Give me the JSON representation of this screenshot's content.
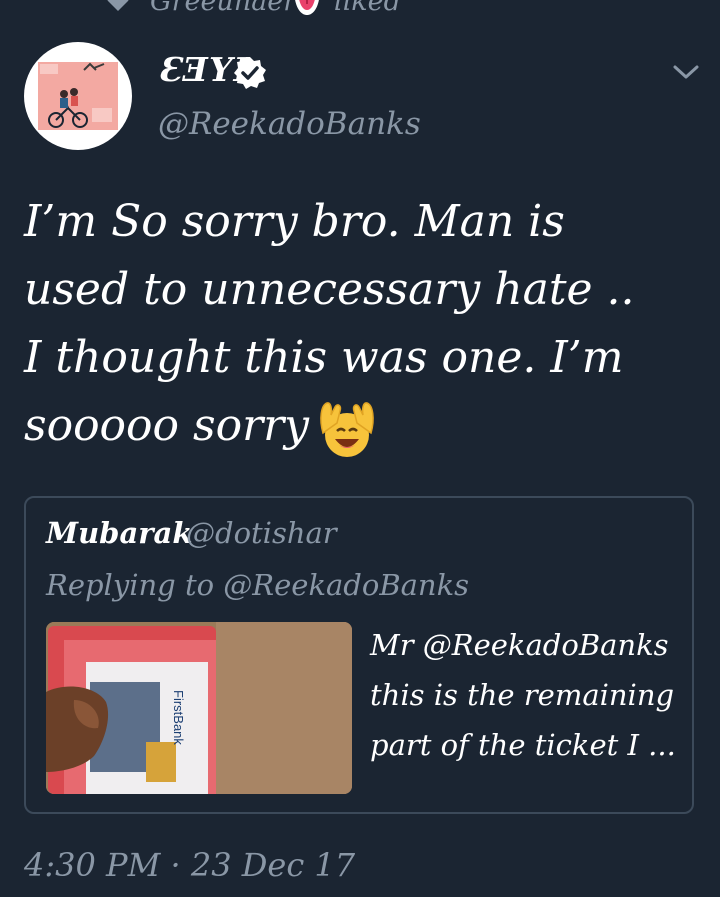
{
  "liked_bar": {
    "user": "Greeunaer",
    "verb": "liked"
  },
  "tweet": {
    "display_name": "ƐƎYI",
    "handle": "@ReekadoBanks",
    "text_lines": [
      "I’m So sorry bro. Man is",
      "used to unnecessary hate ..",
      "I thought this was one. I’m",
      "sooooo sorry"
    ],
    "timestamp": "4:30 PM · 23 Dec 17"
  },
  "quote": {
    "author": "Mubarak",
    "handle": "@dotishar",
    "replying": "Replying to @ReekadoBanks",
    "snippet_lines": [
      "Mr @ReekadoBanks",
      "this is the remaining",
      "part of the ticket I ..."
    ]
  },
  "icons": {
    "verified": "verified-icon",
    "chevron": "chevron-down-icon",
    "heart": "heart-icon",
    "emoji_raise": "raising-hands-emoji"
  },
  "colors": {
    "background": "#1b2532",
    "secondary_text": "#8a97a6",
    "border": "#3c4a5a",
    "verified_badge": "#ffffff"
  }
}
